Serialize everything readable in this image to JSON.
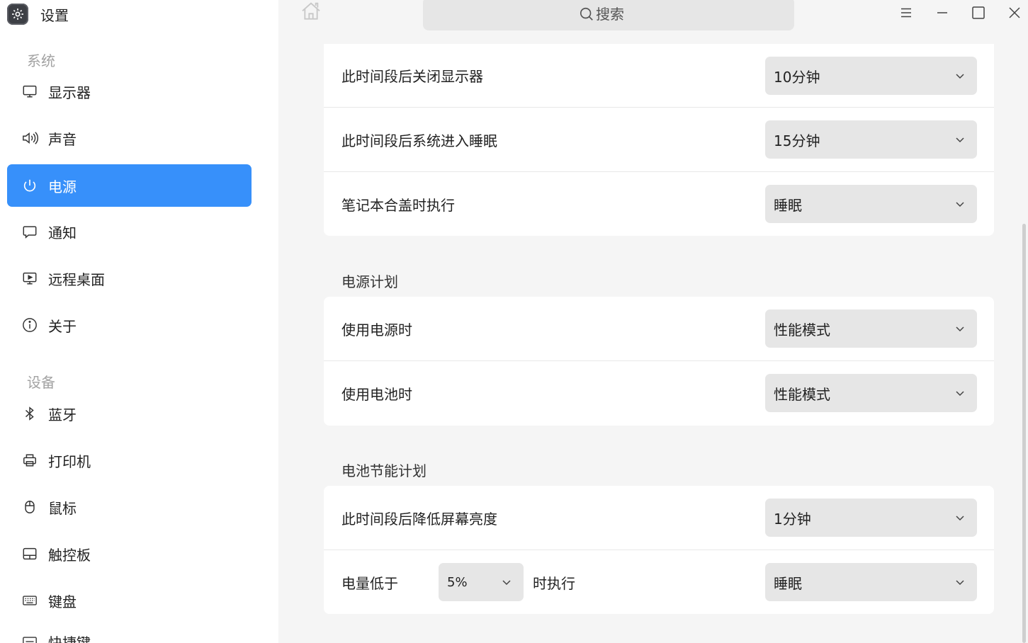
{
  "app": {
    "title": "设置",
    "icon": "gear-icon"
  },
  "search": {
    "placeholder": "搜索"
  },
  "sidebar": {
    "groups": [
      {
        "label": "系统"
      },
      {
        "label": "设备"
      }
    ],
    "items": [
      {
        "label": "显示器",
        "icon": "monitor-icon"
      },
      {
        "label": "声音",
        "icon": "speaker-icon"
      },
      {
        "label": "电源",
        "icon": "power-icon",
        "active": true
      },
      {
        "label": "通知",
        "icon": "chat-bubble-icon"
      },
      {
        "label": "远程桌面",
        "icon": "remote-desktop-icon"
      },
      {
        "label": "关于",
        "icon": "info-icon"
      },
      {
        "label": "蓝牙",
        "icon": "bluetooth-icon"
      },
      {
        "label": "打印机",
        "icon": "printer-icon"
      },
      {
        "label": "鼠标",
        "icon": "mouse-icon"
      },
      {
        "label": "触控板",
        "icon": "touchpad-icon"
      },
      {
        "label": "键盘",
        "icon": "keyboard-icon"
      },
      {
        "label": "快捷键",
        "icon": "shortcut-icon"
      }
    ]
  },
  "general": {
    "rows": [
      {
        "label": "此时间段后关闭显示器",
        "value": "10分钟"
      },
      {
        "label": "此时间段后系统进入睡眠",
        "value": "15分钟"
      },
      {
        "label": "笔记本合盖时执行",
        "value": "睡眠"
      }
    ]
  },
  "power_plan": {
    "title": "电源计划",
    "rows": [
      {
        "label": "使用电源时",
        "value": "性能模式"
      },
      {
        "label": "使用电池时",
        "value": "性能模式"
      }
    ]
  },
  "battery_saving": {
    "title": "电池节能计划",
    "rows": [
      {
        "label": "此时间段后降低屏幕亮度",
        "value": "1分钟"
      },
      {
        "label": "电量低于",
        "threshold": "5%",
        "suffix": "时执行",
        "value": "睡眠"
      }
    ]
  }
}
